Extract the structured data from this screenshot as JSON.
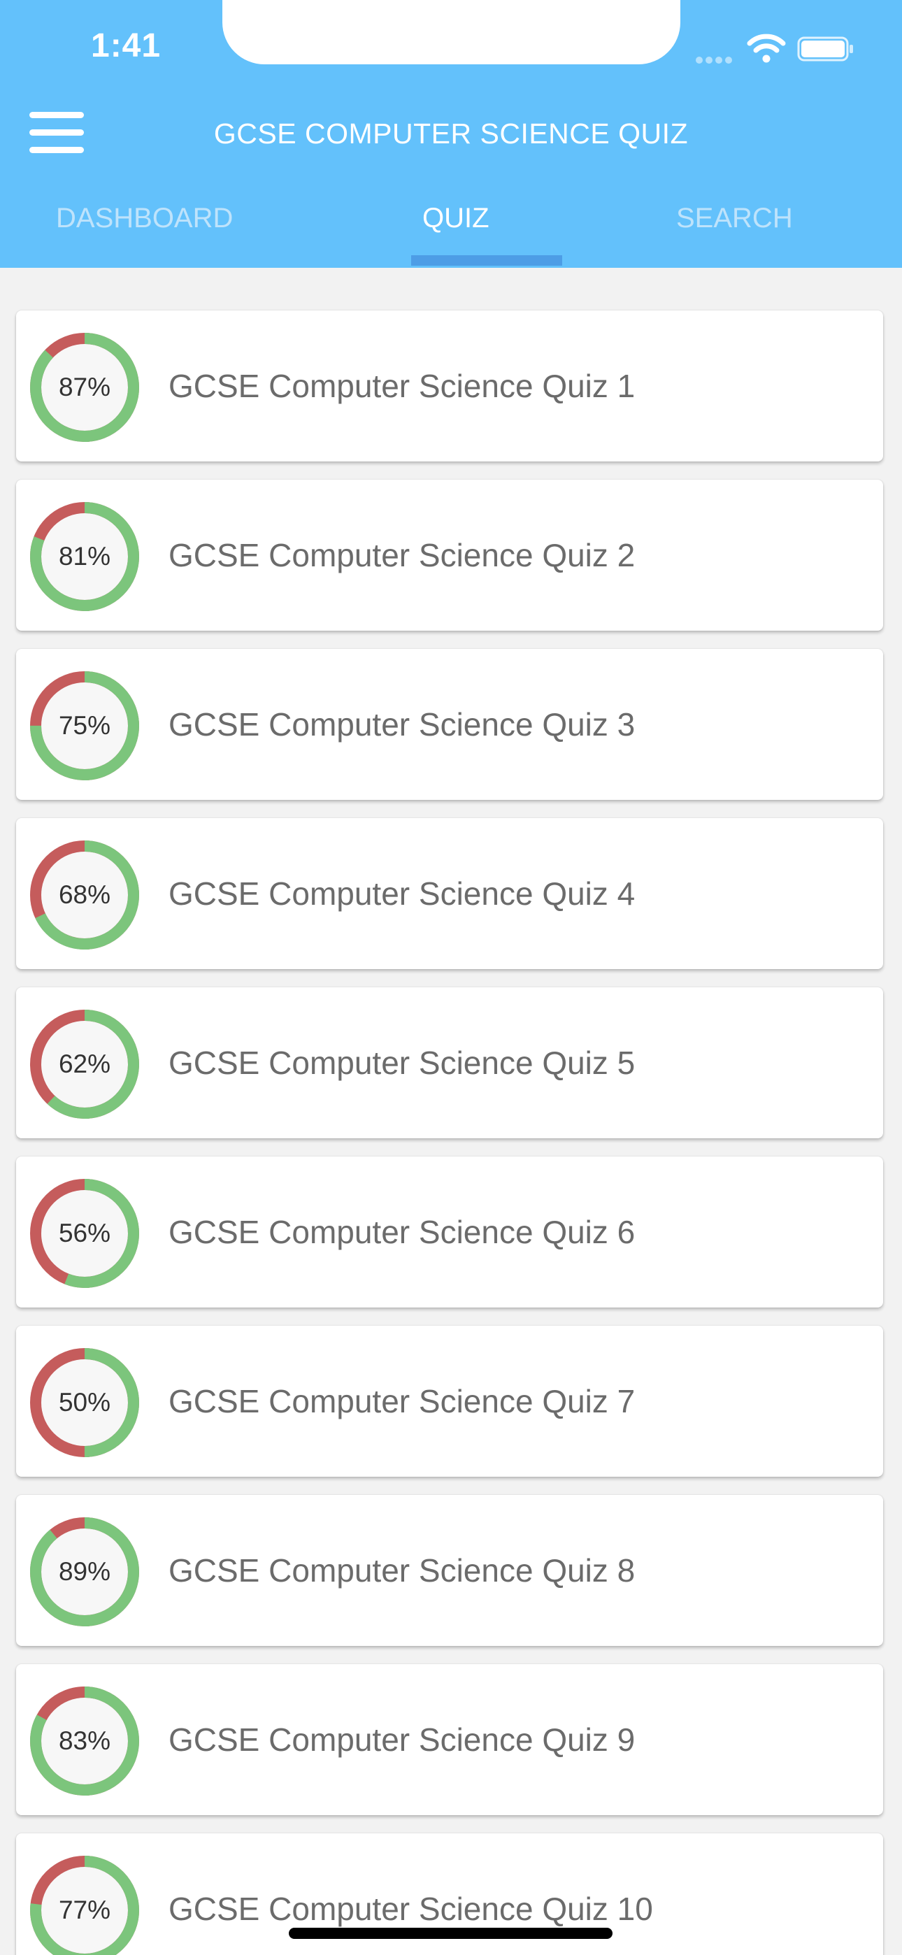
{
  "status_bar": {
    "time": "1:41"
  },
  "header": {
    "title": "GCSE COMPUTER SCIENCE QUIZ",
    "menu_icon": "hamburger-menu-icon"
  },
  "tabs": [
    {
      "label": "DASHBOARD",
      "active": false
    },
    {
      "label": "QUIZ",
      "active": true
    },
    {
      "label": "SEARCH",
      "active": false
    }
  ],
  "colors": {
    "header_bg": "#63c1fb",
    "tab_indicator": "#4d9de6",
    "ring_correct": "#7cc57c",
    "ring_incorrect": "#c55c5c",
    "list_bg": "#f2f2f2"
  },
  "quizzes": [
    {
      "title": "GCSE Computer Science Quiz 1",
      "score_label": "87%",
      "score": 0.87
    },
    {
      "title": "GCSE Computer Science Quiz 2",
      "score_label": "81%",
      "score": 0.81
    },
    {
      "title": "GCSE Computer Science Quiz 3",
      "score_label": "75%",
      "score": 0.75
    },
    {
      "title": "GCSE Computer Science Quiz 4",
      "score_label": "68%",
      "score": 0.68
    },
    {
      "title": "GCSE Computer Science Quiz 5",
      "score_label": "62%",
      "score": 0.62
    },
    {
      "title": "GCSE Computer Science Quiz 6",
      "score_label": "56%",
      "score": 0.56
    },
    {
      "title": "GCSE Computer Science Quiz 7",
      "score_label": "50%",
      "score": 0.5
    },
    {
      "title": "GCSE Computer Science Quiz 8",
      "score_label": "89%",
      "score": 0.89
    },
    {
      "title": "GCSE Computer Science Quiz 9",
      "score_label": "83%",
      "score": 0.83
    },
    {
      "title": "GCSE Computer Science Quiz 10",
      "score_label": "77%",
      "score": 0.77
    }
  ]
}
